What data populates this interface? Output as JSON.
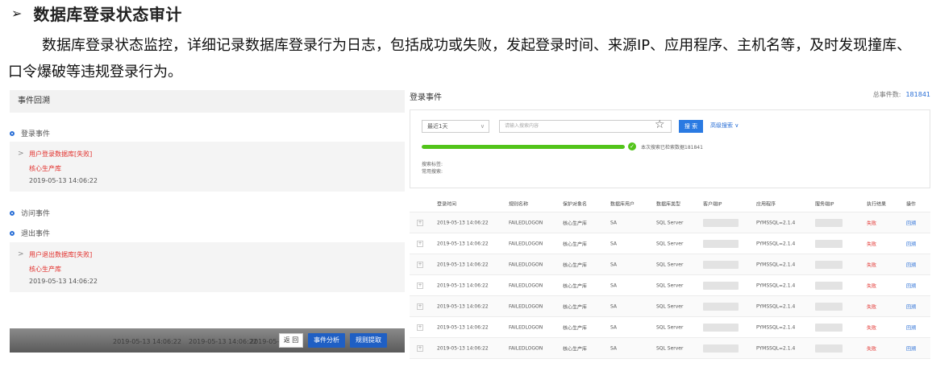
{
  "document": {
    "bullet": "➢",
    "heading": "数据库登录状态审计",
    "paragraph": "数据库登录状态监控，详细记录数据库登录行为日志，包括成功或失败，发起登录时间、来源IP、应用程序、主机名等，及时发现撞库、口令爆破等违规登录行为。"
  },
  "left_panel": {
    "header": "事件回溯",
    "categories": [
      {
        "label": "登录事件"
      },
      {
        "label": "访问事件"
      },
      {
        "label": "退出事件"
      }
    ],
    "cards": [
      {
        "title": "用户登录数据库[失败]",
        "object": "核心生产库",
        "time": "2019-05-13 14:06:22"
      },
      {
        "title": "用户退出数据库[失败]",
        "object": "核心生产库",
        "time": "2019-05-13 14:06:22"
      }
    ],
    "footer": {
      "ghost_texts": [
        "2019-05-13 14:06:22",
        "2019-05-13 14:06:22",
        "2019-05-13"
      ],
      "back_label": "返 回",
      "analysis_label": "事件分析",
      "extract_label": "规则提取"
    }
  },
  "right_panel": {
    "title": "登录事件",
    "total_label": "总事件数:",
    "total_value": "181841",
    "search": {
      "range": "最近1天",
      "keyword_placeholder": "请输入搜索内容",
      "search_label": "搜 索",
      "advanced_label": "高级搜索 ∨",
      "progress_fraction": 1.0,
      "progress_text": "本次搜索已检索数据181841",
      "tag_label": "搜索标签:",
      "common_label": "常用搜索:"
    },
    "table": {
      "headers": [
        "登录时间",
        "规则名称",
        "保护对象名",
        "数据库用户",
        "数据库类型",
        "客户端IP",
        "应用程序",
        "服务端IP",
        "执行结果",
        "操作"
      ],
      "rows": [
        {
          "time": "2019-05-13 14:06:22",
          "rule": "FAILEDLOGON",
          "object": "核心生产库",
          "user": "SA",
          "dbtype": "SQL Server",
          "app": "PYMSSQL=2.1.4",
          "result": "失败",
          "op": "回溯"
        },
        {
          "time": "2019-05-13 14:06:22",
          "rule": "FAILEDLOGON",
          "object": "核心生产库",
          "user": "SA",
          "dbtype": "SQL Server",
          "app": "PYMSSQL=2.1.4",
          "result": "失败",
          "op": "回溯"
        },
        {
          "time": "2019-05-13 14:06:22",
          "rule": "FAILEDLOGON",
          "object": "核心生产库",
          "user": "SA",
          "dbtype": "SQL Server",
          "app": "PYMSSQL=2.1.4",
          "result": "失败",
          "op": "回溯"
        },
        {
          "time": "2019-05-13 14:06:22",
          "rule": "FAILEDLOGON",
          "object": "核心生产库",
          "user": "SA",
          "dbtype": "SQL Server",
          "app": "PYMSSQL=2.1.4",
          "result": "失败",
          "op": "回溯"
        },
        {
          "time": "2019-05-13 14:06:22",
          "rule": "FAILEDLOGON",
          "object": "核心生产库",
          "user": "SA",
          "dbtype": "SQL Server",
          "app": "PYMSSQL=2.1.4",
          "result": "失败",
          "op": "回溯"
        },
        {
          "time": "2019-05-13 14:06:22",
          "rule": "FAILEDLOGON",
          "object": "核心生产库",
          "user": "SA",
          "dbtype": "SQL Server",
          "app": "PYMSSQL=2.1.4",
          "result": "失败",
          "op": "回溯"
        },
        {
          "time": "2019-05-13 14:06:22",
          "rule": "FAILEDLOGON",
          "object": "核心生产库",
          "user": "SA",
          "dbtype": "SQL Server",
          "app": "PYMSSQL=2.1.4",
          "result": "失败",
          "op": "回溯"
        }
      ]
    }
  },
  "colors": {
    "accent": "#2a6fd6",
    "fail": "#e2312d",
    "success": "#52c41a"
  }
}
